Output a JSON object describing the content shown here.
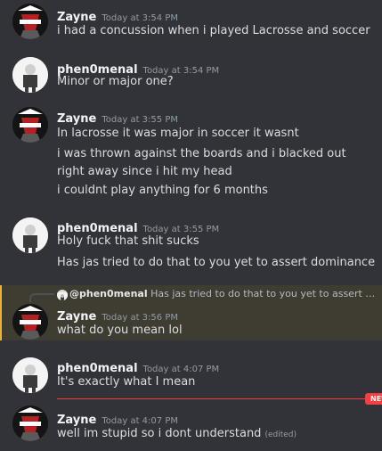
{
  "colors": {
    "background": "#313338",
    "highlight": "#3f3c32",
    "highlight_bar": "#f0b232",
    "new_divider": "#f23f43"
  },
  "messages": [
    {
      "author": "Zayne",
      "timestamp": "Today at 3:54 PM",
      "lines": [
        "i had a concussion when i played Lacrosse and soccer"
      ]
    },
    {
      "author": "phen0menal",
      "timestamp": "Today at 3:54 PM",
      "lines": [
        "Minor or major one?"
      ]
    },
    {
      "author": "Zayne",
      "timestamp": "Today at 3:55 PM",
      "lines": [
        "In lacrosse it was major in soccer it wasnt",
        "i was thrown against the boards and i blacked out right away since i hit my head",
        "i couldnt play anything for 6 months"
      ]
    },
    {
      "author": "phen0menal",
      "timestamp": "Today at 3:55 PM",
      "lines": [
        "Holy fuck that shit sucks",
        "Has jas tried to do that to you yet to assert dominance"
      ]
    },
    {
      "author": "Zayne",
      "timestamp": "Today at 3:56 PM",
      "lines": [
        "what do you mean lol"
      ],
      "reply": {
        "mention": "@phen0menal",
        "text": "Has jas tried to do that to you yet to assert d..."
      }
    },
    {
      "author": "phen0menal",
      "timestamp": "Today at 4:07 PM",
      "lines": [
        "It's exactly what I mean"
      ]
    },
    {
      "author": "Zayne",
      "timestamp": "Today at 4:07 PM",
      "lines": [
        "well im stupid so i dont understand"
      ],
      "edited": "(edited)"
    }
  ],
  "new_badge": "NEW",
  "avatars": {
    "zayne": "wizard-avatar-icon",
    "phen0menal": "white-character-avatar-icon"
  }
}
